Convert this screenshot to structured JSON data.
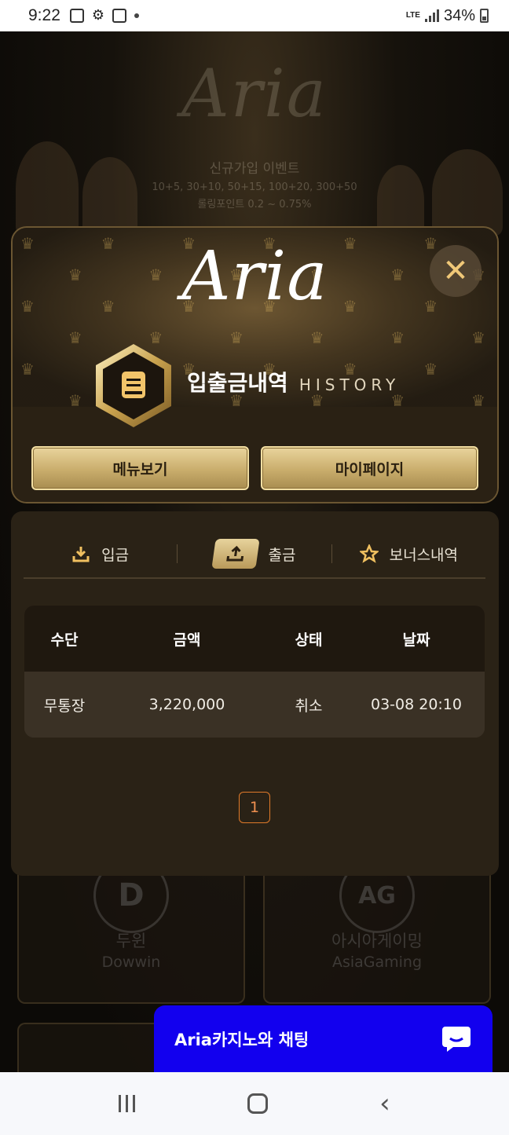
{
  "status_bar": {
    "time": "9:22",
    "network": "LTE",
    "battery": "34%"
  },
  "background": {
    "logo": "Aria",
    "event_title": "신규가입 이벤트",
    "event_line1": "10+5, 30+10, 50+15, 100+20, 300+50",
    "event_line2": "롤링포인트 0.2 ~ 0.75%",
    "cards": [
      {
        "glyph": "D",
        "name_ko": "두윈",
        "name_en": "Dowwin"
      },
      {
        "glyph": "AG",
        "name_ko": "아시아게이밍",
        "name_en": "AsiaGaming"
      }
    ]
  },
  "modal": {
    "logo": "Aria",
    "close_symbol": "✕",
    "title_ko": "입출금내역",
    "title_en": "HISTORY",
    "menu_button": "메뉴보기",
    "mypage_button": "마이페이지",
    "tabs": [
      {
        "label": "입금",
        "icon": "download-icon",
        "active": false
      },
      {
        "label": "출금",
        "icon": "upload-icon",
        "active": true
      },
      {
        "label": "보너스내역",
        "icon": "star-icon",
        "active": false
      }
    ],
    "table": {
      "headers": [
        "수단",
        "금액",
        "상태",
        "날짜"
      ],
      "rows": [
        [
          "무통장",
          "3,220,000",
          "취소",
          "03-08 20:10"
        ]
      ]
    },
    "pagination": {
      "current": "1"
    }
  },
  "chat": {
    "label": "Aria카지노와 채팅",
    "color": "#1200ee"
  },
  "colors": {
    "gold": "#e9d49c",
    "accent_orange": "#e07a2a",
    "panel": "#2a2216"
  }
}
